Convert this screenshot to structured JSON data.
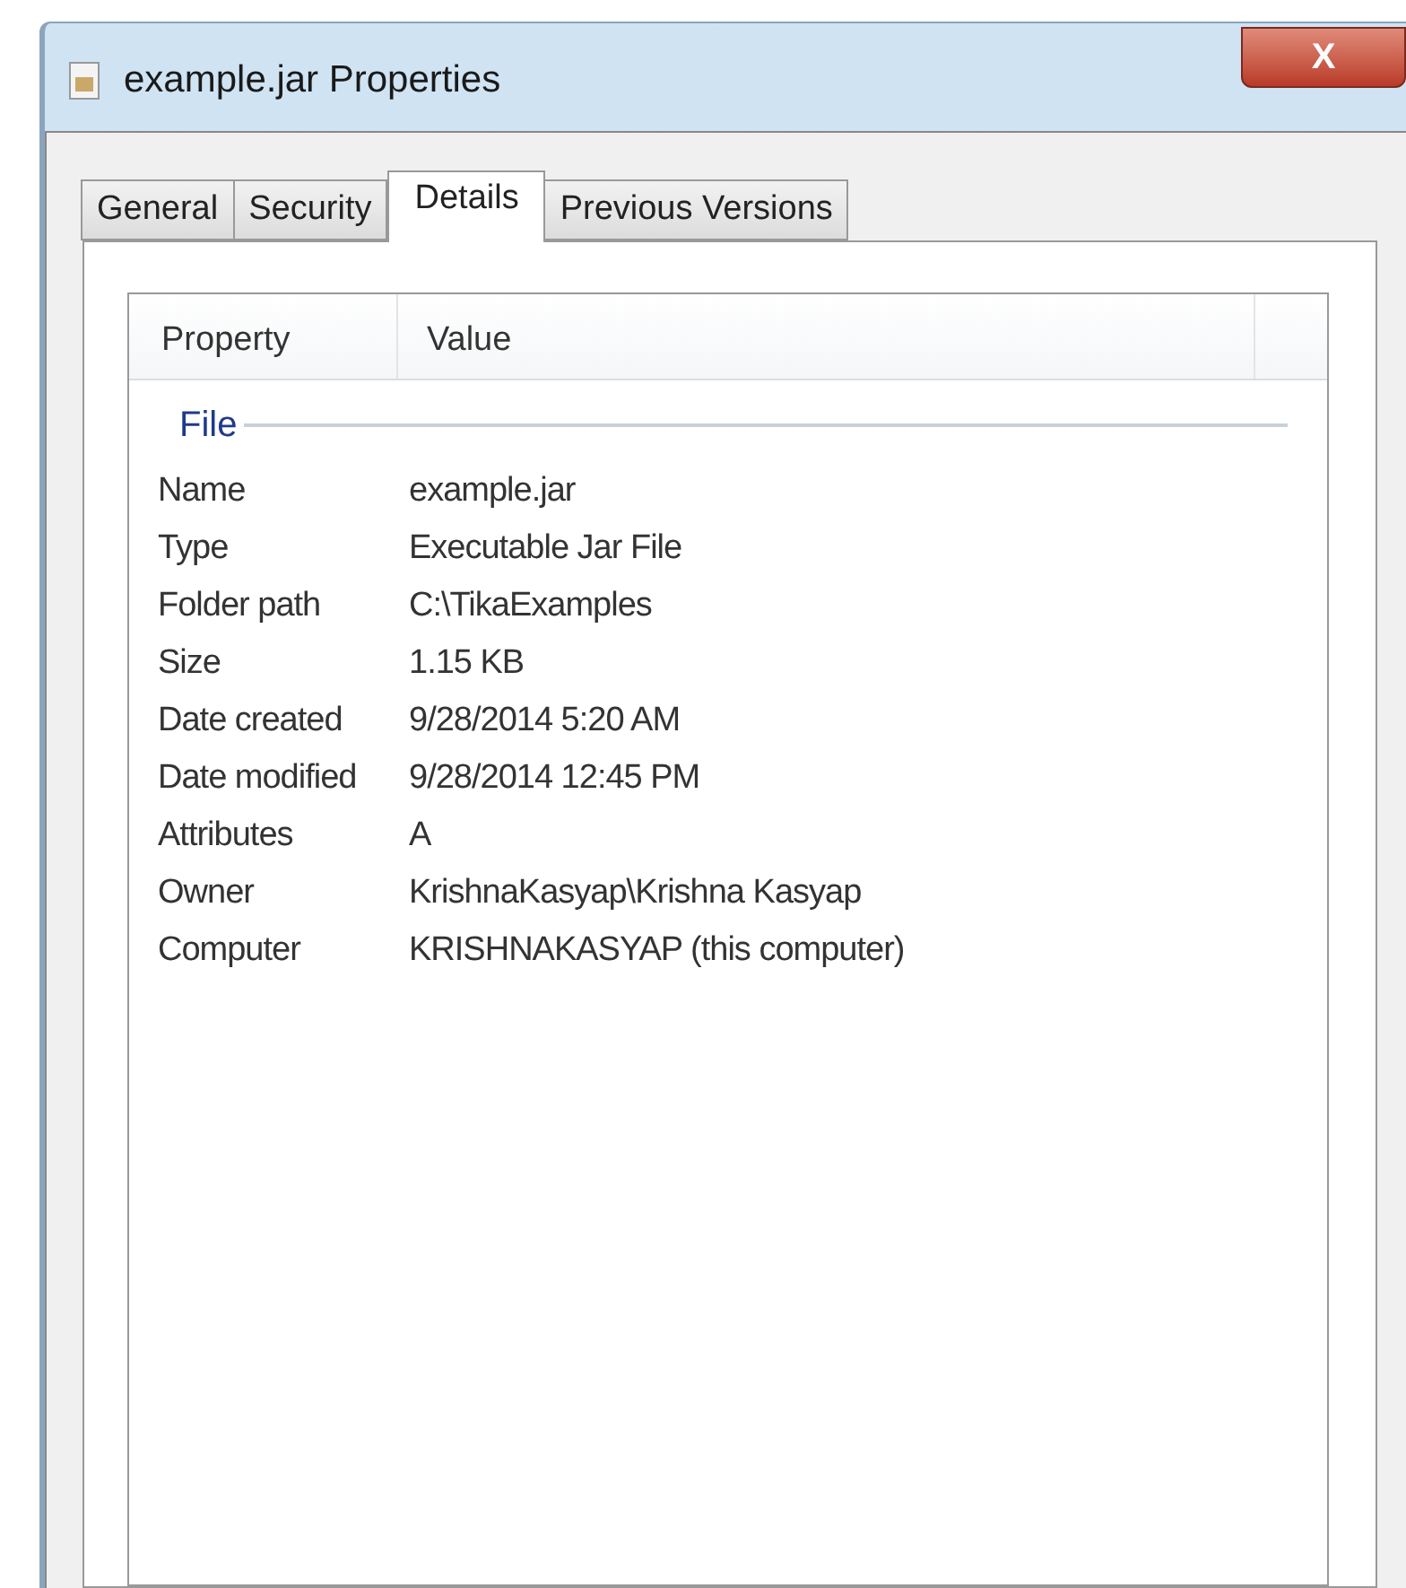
{
  "window": {
    "title": "example.jar Properties",
    "close": "X"
  },
  "tabs": [
    {
      "label": "General",
      "selected": false
    },
    {
      "label": "Security",
      "selected": false
    },
    {
      "label": "Details",
      "selected": true
    },
    {
      "label": "Previous Versions",
      "selected": false
    }
  ],
  "list": {
    "columns": [
      "Property",
      "Value"
    ],
    "group": "File",
    "rows": [
      {
        "property": "Name",
        "value": "example.jar"
      },
      {
        "property": "Type",
        "value": "Executable Jar File"
      },
      {
        "property": "Folder path",
        "value": "C:\\TikaExamples"
      },
      {
        "property": "Size",
        "value": "1.15 KB"
      },
      {
        "property": "Date created",
        "value": "9/28/2014 5:20 AM"
      },
      {
        "property": "Date modified",
        "value": "9/28/2014 12:45 PM"
      },
      {
        "property": "Attributes",
        "value": "A"
      },
      {
        "property": "Owner",
        "value": "KrishnaKasyap\\Krishna Kasyap"
      },
      {
        "property": "Computer",
        "value": "KRISHNAKASYAP (this computer)"
      }
    ]
  }
}
